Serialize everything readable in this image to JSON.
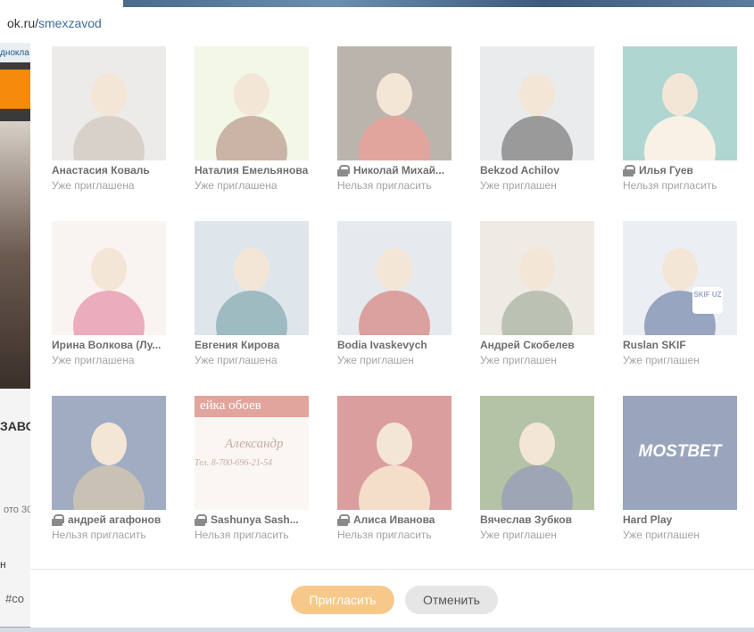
{
  "browser": {
    "url_domain": "ok.ru/",
    "url_path": "smexzavod"
  },
  "background": {
    "nav_text": "дноклa",
    "title_fragment": "ЗАВО",
    "photo_count_fragment": "ото 30",
    "side_letter": "н",
    "hashtag_fragment": "#co"
  },
  "friends": [
    {
      "name": "Анастасия Коваль",
      "status": "Уже приглашена",
      "locked": false,
      "bg": "#d9d4cf",
      "accent": "#a89a8c"
    },
    {
      "name": "Наталия Емельянова",
      "status": "Уже приглашена",
      "locked": false,
      "bg": "#e6efc9",
      "accent": "#8a5a3c"
    },
    {
      "name": "Николай Михай...",
      "status": "Нельзя пригласить",
      "locked": true,
      "bg": "#6a5a4c",
      "accent": "#c0392b"
    },
    {
      "name": "Bekzod Achilov",
      "status": "Уже приглашен",
      "locked": false,
      "bg": "#cfd3d6",
      "accent": "#222222"
    },
    {
      "name": "Илья Гуев",
      "status": "Нельзя пригласить",
      "locked": true,
      "bg": "#4fa69a",
      "accent": "#f2e2c4"
    },
    {
      "name": "Ирина Волкова (Лу...",
      "status": "Уже приглашена",
      "locked": false,
      "bg": "#f3e6e2",
      "accent": "#d44a6a"
    },
    {
      "name": "Евгения Кирова",
      "status": "Уже приглашена",
      "locked": false,
      "bg": "#b8c9d6",
      "accent": "#2a6a7a"
    },
    {
      "name": "Bodia Ivaskevych",
      "status": "Уже приглашен",
      "locked": false,
      "bg": "#c8d2da",
      "accent": "#b0302a"
    },
    {
      "name": "Андрей Скобелев",
      "status": "Уже приглашен",
      "locked": false,
      "bg": "#dad3c4",
      "accent": "#6a7a5a"
    },
    {
      "name": "Ruslan SKIF",
      "status": "Уже приглашен",
      "locked": false,
      "bg": "#d5dbe6",
      "accent": "#1d3a78"
    },
    {
      "name": "андрей агафонов",
      "status": "Нельзя пригласить",
      "locked": true,
      "bg": "#2f4a7a",
      "accent": "#8a7a5a"
    },
    {
      "name": "Sashunya Sash...",
      "status": "Нельзя пригласить",
      "locked": true,
      "bg": "#f3ece6",
      "accent": "#c0392b"
    },
    {
      "name": "Алиса Иванова",
      "status": "Нельзя пригласить",
      "locked": true,
      "bg": "#b02a2a",
      "accent": "#e8b88a"
    },
    {
      "name": "Вячеслав Зубков",
      "status": "Уже приглашен",
      "locked": false,
      "bg": "#5a7a3a",
      "accent": "#2a3a5a"
    },
    {
      "name": "Hard Play",
      "status": "Уже приглашен",
      "locked": false,
      "bg": "#1e3a6e",
      "accent": "#ffffff"
    }
  ],
  "photo_texts": {
    "sign_top": "ейка обоев",
    "sign_name": "Александр",
    "sign_phone": "Тел. 8-700-696-21-54",
    "skif_badge": "SKIF UZ",
    "mostbet": "MOSTBET"
  },
  "footer": {
    "invite_label": "Пригласить",
    "cancel_label": "Отменить"
  }
}
